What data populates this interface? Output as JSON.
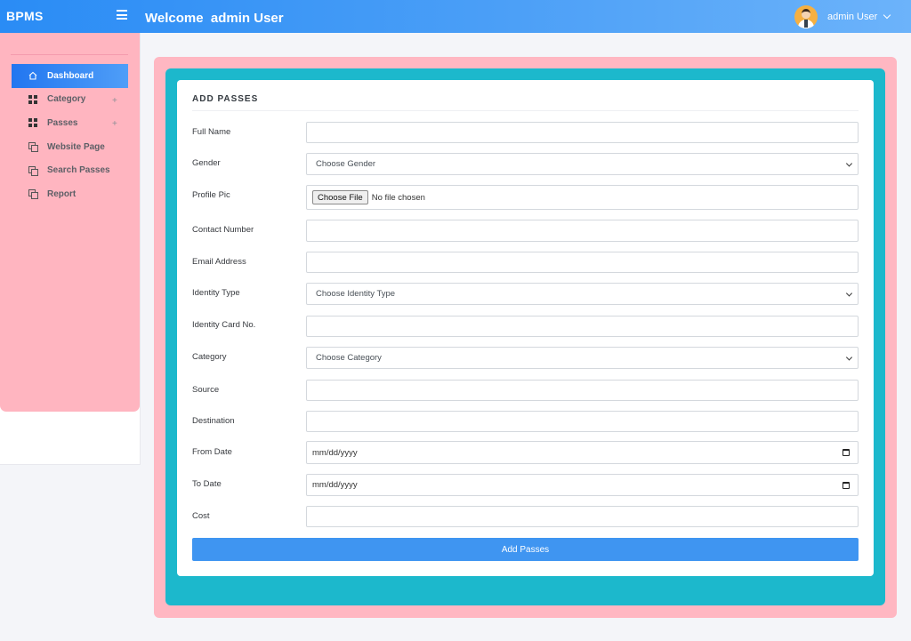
{
  "header": {
    "brand": "BPMS",
    "welcome": "Welcome  admin User",
    "user_name": "admin User"
  },
  "sidebar": {
    "items": [
      {
        "label": "Dashboard",
        "icon": "home-icon",
        "active": true
      },
      {
        "label": "Category",
        "icon": "grid-icon",
        "expand": "+"
      },
      {
        "label": "Passes",
        "icon": "grid-icon",
        "expand": "+"
      },
      {
        "label": "Website Page",
        "icon": "copy-icon"
      },
      {
        "label": "Search Passes",
        "icon": "copy-icon"
      },
      {
        "label": "Report",
        "icon": "copy-icon"
      }
    ]
  },
  "form": {
    "title": "ADD PASSES",
    "full_name_label": "Full Name",
    "gender_label": "Gender",
    "gender_value": "Choose Gender",
    "profile_pic_label": "Profile Pic",
    "file_button": "Choose File",
    "file_status": "No file chosen",
    "contact_label": "Contact Number",
    "email_label": "Email Address",
    "identity_type_label": "Identity Type",
    "identity_type_value": "Choose Identity Type",
    "identity_card_label": "Identity Card No.",
    "category_label": "Category",
    "category_value": "Choose Category",
    "source_label": "Source",
    "destination_label": "Destination",
    "from_date_label": "From Date",
    "from_date_value": "mm/dd/yyyy",
    "to_date_label": "To Date",
    "to_date_value": "mm/dd/yyyy",
    "cost_label": "Cost",
    "submit_label": "Add Passes"
  },
  "colors": {
    "header_start": "#2a8cf5",
    "sidebar_bg": "#ffb5c0",
    "panel_teal": "#1cb8cc",
    "button_blue": "#3f95f1"
  }
}
